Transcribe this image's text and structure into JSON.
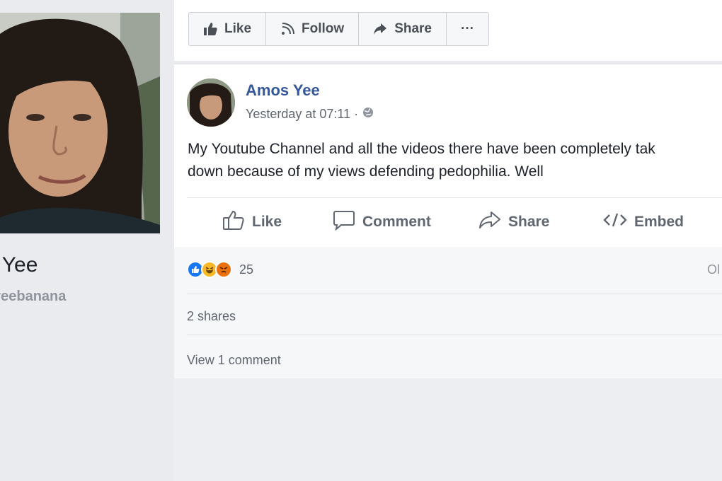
{
  "profile": {
    "name": "s Yee",
    "handle": "yeebanana"
  },
  "page_actions": [
    {
      "label": "Like",
      "icon": "thumbs-up-icon"
    },
    {
      "label": "Follow",
      "icon": "rss-icon"
    },
    {
      "label": "Share",
      "icon": "share-arrow-icon"
    },
    {
      "label": "···",
      "icon": "more-icon"
    }
  ],
  "post": {
    "author": "Amos Yee",
    "timestamp": "Yesterday at 07:11 ·",
    "privacy_icon": "globe-icon",
    "text_lines": [
      "My Youtube Channel and all the videos there have been completely tak",
      "down because of my views defending pedophilia. Well"
    ],
    "actions": {
      "like": "Like",
      "comment": "Comment",
      "share": "Share",
      "embed": "Embed"
    },
    "reactions": {
      "icons": [
        "like-reaction-icon",
        "haha-reaction-icon",
        "angry-reaction-icon"
      ],
      "count": "25",
      "other": "Ol"
    },
    "shares": "2 shares",
    "view_comments": "View 1 comment"
  },
  "colors": {
    "link_blue": "#365899",
    "like_blue": "#1877f2",
    "haha_yellow": "#f7b928",
    "angry_orange": "#e9710f",
    "page_bg": "#e9ebee"
  }
}
